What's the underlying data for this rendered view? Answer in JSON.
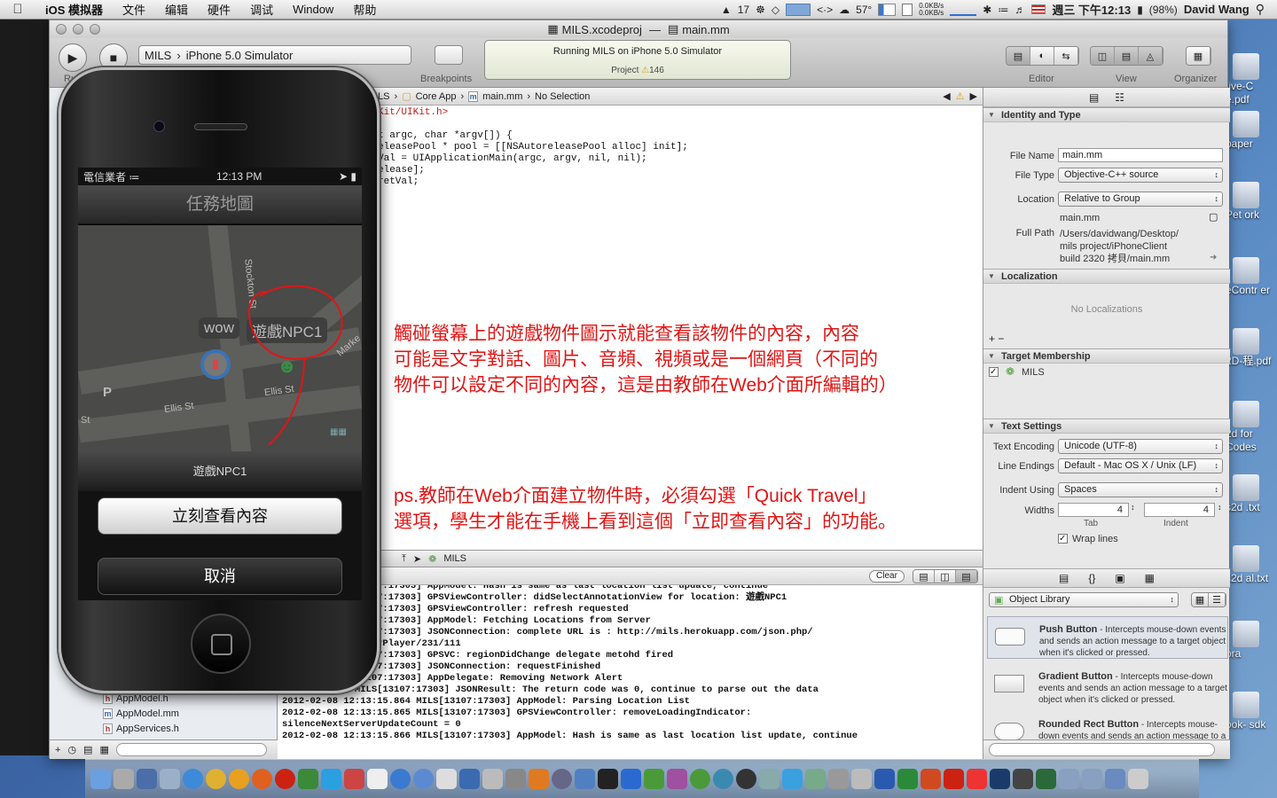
{
  "menubar": {
    "apple": "",
    "app_name": "iOS 模拟器",
    "menus": [
      "文件",
      "编辑",
      "硬件",
      "调试",
      "Window",
      "帮助"
    ],
    "status": {
      "calendar": "17",
      "temp": "57°",
      "net_up": "0.0KB/s",
      "net_down": "0.0KB/s",
      "datetime": "週三 下午12:13",
      "battery": "(98%)",
      "user": "David Wang"
    }
  },
  "xcode": {
    "title": "MILS.xcodeproj",
    "title_sep": "—",
    "file": "main.mm",
    "scheme": {
      "project": "MILS",
      "device": "iPhone 5.0 Simulator"
    },
    "run_label": "Ru",
    "breakpoints_label": "Breakpoints",
    "activity": {
      "status": "Running MILS on iPhone 5.0 Simulator",
      "project_label": "Project",
      "warnings": "146"
    },
    "toolbar_labels": {
      "editor": "Editor",
      "view": "View",
      "organizer": "Organizer"
    },
    "jumpbar": {
      "project": "ILS",
      "group": "Core App",
      "file": "main.mm",
      "selection": "No Selection"
    },
    "code_lines": [
      "Kit/UIKit.h>",
      "",
      "t argc, char *argv[]) {",
      "eleasePool * pool = [[NSAutoreleasePool alloc] init];",
      "Val = UIApplicationMain(argc, argv, nil, nil);",
      "elease];",
      "retVal;"
    ],
    "annotation_1": [
      "觸碰螢幕上的遊戲物件圖示就能查看該物件的內容，內容",
      "可能是文字對話、圖片、音頻、視頻或是一個網頁（不同的",
      "物件可以設定不同的內容，這是由教師在Web介面所編輯的）"
    ],
    "annotation_2": [
      "ps.教師在Web介面建立物件時，必須勾選「Quick Travel」",
      "選項，學生才能在手機上看到這個「立即查看內容」的功能。"
    ],
    "debug_target": "MILS",
    "clear_label": "Clear",
    "console": [
      ":15.737 MILS[13107:17303] AppModel: Hash is same as last location list update, continue",
      ":11.514 MILS[13107:17303] GPSViewController: didSelectAnnotationView for location: 遊戲NPC1",
      ":15.410 MILS[13107:17303] GPSViewController: refresh requested",
      ":15.411 MILS[13107:17303] AppModel: Fetching Locations from Server",
      ":15.411 MILS[13107:17303] JSONConnection: complete URL is : http://mils.herokuapp.com/json.php/",
      "ns.getLocationsForPlayer/231/111",
      ":15.413 MILS[13107:17303] GPSVC: regionDidChange delegate metohd fired",
      ":15.863 MILS[13107:17303] JSONConnection: requestFinished",
      ":15.863 MILS[13107:17303] AppDelegate: Removing Network Alert",
      "12:13:15.864 MILS[13107:17303] JSONResult: The return code was 0, continue to parse out the data",
      "2012-02-08 12:13:15.864 MILS[13107:17303] AppModel: Parsing Location List",
      "2012-02-08 12:13:15.865 MILS[13107:17303] GPSViewController: removeLoadingIndicator:",
      "silenceNextServerUpdateCount = 0",
      "2012-02-08 12:13:15.866 MILS[13107:17303] AppModel: Hash is same as last location list update, continue"
    ],
    "navigator_files": [
      "AppModel.h",
      "AppModel.mm",
      "AppServices.h"
    ],
    "inspector": {
      "identity_header": "Identity and Type",
      "file_name_label": "File Name",
      "file_name": "main.mm",
      "file_type_label": "File Type",
      "file_type": "Objective-C++ source",
      "location_label": "Location",
      "location": "Relative to Group",
      "location_file": "main.mm",
      "full_path_label": "Full Path",
      "full_path": [
        "/Users/davidwang/Desktop/",
        "mils project/iPhoneClient",
        "build 2320 拷貝/main.mm"
      ],
      "localization_header": "Localization",
      "no_localizations": "No Localizations",
      "target_header": "Target Membership",
      "target": "MILS",
      "text_settings_header": "Text Settings",
      "encoding_label": "Text Encoding",
      "encoding": "Unicode (UTF-8)",
      "line_endings_label": "Line Endings",
      "line_endings": "Default - Mac OS X / Unix (LF)",
      "indent_using_label": "Indent Using",
      "indent_using": "Spaces",
      "widths_label": "Widths",
      "tab_width": "4",
      "indent_width": "4",
      "tab_label": "Tab",
      "indent_label": "Indent",
      "wrap_lines": "Wrap lines",
      "library_select": "Object Library",
      "library_items": [
        {
          "name": "Push Button",
          "desc": " - Intercepts mouse-down events and sends an action message to a target object when it's clicked or pressed."
        },
        {
          "name": "Gradient Button",
          "desc": " - Intercepts mouse-down events and sends an action message to a target object when it's clicked or pressed."
        },
        {
          "name": "Rounded Rect Button",
          "desc": " - Intercepts mouse-down events and sends an action message to a target object when it's..."
        }
      ]
    }
  },
  "simulator": {
    "carrier": "電信業者",
    "time": "12:13 PM",
    "nav_title": "任務地圖",
    "map_labels": {
      "stockton": "Stockton St",
      "ellis1": "Ellis St",
      "ellis2": "Ellis St",
      "st": "St",
      "p": "P",
      "market": "Marke"
    },
    "pins": [
      "wow",
      "遊戲NPC1"
    ],
    "sheet_title": "遊戲NPC1",
    "view_button": "立刻查看內容",
    "cancel_button": "取消"
  },
  "desktop_icons": [
    "tive-C e.pdf",
    "paper",
    "Pet ork",
    "eContr er",
    "2D-程.pdf",
    "2d for Codes",
    "s2d .txt",
    "s2d al.txt",
    "ora",
    "ook- sdk"
  ]
}
